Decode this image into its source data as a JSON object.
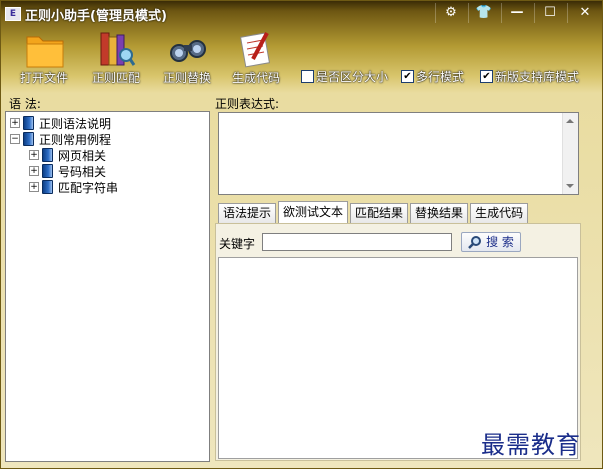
{
  "window": {
    "icon_glyph": "E",
    "title": "正则小助手(管理员模式)",
    "controls": {
      "settings": "⚙",
      "skin": "👕",
      "minimize": "—",
      "maximize": "☐",
      "close": "✕"
    }
  },
  "toolbar": {
    "open_file": "打开文件",
    "regex_match": "正则匹配",
    "regex_replace": "正则替换",
    "generate_code": "生成代码"
  },
  "options": {
    "case_sensitive": {
      "label": "是否区分大小",
      "checked": false
    },
    "multiline": {
      "label": "多行模式",
      "checked": true
    },
    "new_lib": {
      "label": "新版支持库模式",
      "checked": true
    }
  },
  "left": {
    "label": "语 法:",
    "tree": [
      {
        "label": "正则语法说明",
        "expander": "+",
        "level": 0
      },
      {
        "label": "正则常用例程",
        "expander": "−",
        "level": 0
      },
      {
        "label": "网页相关",
        "expander": "+",
        "level": 1
      },
      {
        "label": "号码相关",
        "expander": "+",
        "level": 1
      },
      {
        "label": "匹配字符串",
        "expander": "+",
        "level": 1
      }
    ]
  },
  "right": {
    "regex_label": "正则表达式:",
    "regex_value": "",
    "tabs": [
      "语法提示",
      "欲测试文本",
      "匹配结果",
      "替换结果",
      "生成代码"
    ],
    "active_tab": "欲测试文本",
    "keyword_label": "关键字",
    "keyword_value": "",
    "search_button": "搜 索",
    "results_text": ""
  },
  "watermark": "最需教育",
  "colors": {
    "accent_gold": "#b39a33",
    "checkbox_border": "#1c3d6e"
  }
}
